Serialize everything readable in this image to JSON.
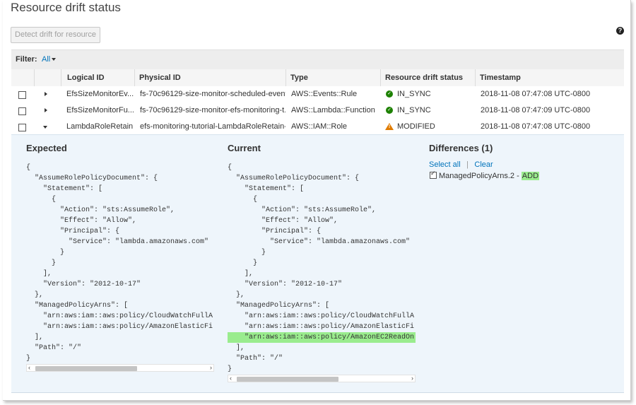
{
  "title": "Resource drift status",
  "detect_button": "Detect drift for resource",
  "help_icon": "?",
  "filter": {
    "label": "Filter:",
    "value": "All"
  },
  "columns": [
    "Logical ID",
    "Physical ID",
    "Type",
    "Resource drift status",
    "Timestamp"
  ],
  "rows": [
    {
      "logical_id": "EfsSizeMonitorEv...",
      "physical_id": "fs-70c96129-size-monitor-scheduled-event...",
      "type": "AWS::Events::Rule",
      "status": "IN_SYNC",
      "status_icon": "check-circle-icon",
      "timestamp": "2018-11-08 07:47:08 UTC-0800"
    },
    {
      "logical_id": "EfsSizeMonitorFu...",
      "physical_id": "fs-70c96129-size-monitor-efs-monitoring-t...",
      "type": "AWS::Lambda::Function",
      "status": "IN_SYNC",
      "status_icon": "check-circle-icon",
      "timestamp": "2018-11-08 07:47:09 UTC-0800"
    },
    {
      "logical_id": "LambdaRoleRetain",
      "physical_id": "efs-monitoring-tutorial-LambdaRoleRetain-...",
      "type": "AWS::IAM::Role",
      "status": "MODIFIED",
      "status_icon": "warning-icon",
      "timestamp": "2018-11-08 07:47:08 UTC-0800"
    }
  ],
  "colors": {
    "in_sync": "#1d8102",
    "modified": "#e07b00",
    "added_highlight": "#9aec8e",
    "link": "#0073bb",
    "detail_bg": "#eef5fb"
  },
  "detail": {
    "expected": {
      "heading": "Expected",
      "lines": [
        "{",
        "  \"AssumeRolePolicyDocument\": {",
        "    \"Statement\": [",
        "      {",
        "        \"Action\": \"sts:AssumeRole\",",
        "        \"Effect\": \"Allow\",",
        "        \"Principal\": {",
        "          \"Service\": \"lambda.amazonaws.com\"",
        "        }",
        "      }",
        "    ],",
        "    \"Version\": \"2012-10-17\"",
        "  },",
        "  \"ManagedPolicyArns\": [",
        "    \"arn:aws:iam::aws:policy/CloudWatchFullA",
        "    \"arn:aws:iam::aws:policy/AmazonElasticFi",
        "  ],",
        "  \"Path\": \"/\"",
        "}"
      ]
    },
    "current": {
      "heading": "Current",
      "added_line_index": 16,
      "lines": [
        "{",
        "  \"AssumeRolePolicyDocument\": {",
        "    \"Statement\": [",
        "      {",
        "        \"Action\": \"sts:AssumeRole\",",
        "        \"Effect\": \"Allow\",",
        "        \"Principal\": {",
        "          \"Service\": \"lambda.amazonaws.com\"",
        "        }",
        "      }",
        "    ],",
        "    \"Version\": \"2012-10-17\"",
        "  },",
        "  \"ManagedPolicyArns\": [",
        "    \"arn:aws:iam::aws:policy/CloudWatchFullA",
        "    \"arn:aws:iam::aws:policy/AmazonElasticFi",
        "    \"arn:aws:iam::aws:policy/AmazonEC2ReadOn",
        "  ],",
        "  \"Path\": \"/\"",
        "}"
      ]
    },
    "differences": {
      "heading": "Differences (1)",
      "select_all": "Select all",
      "separator": "|",
      "clear": "Clear",
      "items": [
        {
          "path": "ManagedPolicyArns.2",
          "dash": " - ",
          "change": "ADD"
        }
      ]
    }
  }
}
